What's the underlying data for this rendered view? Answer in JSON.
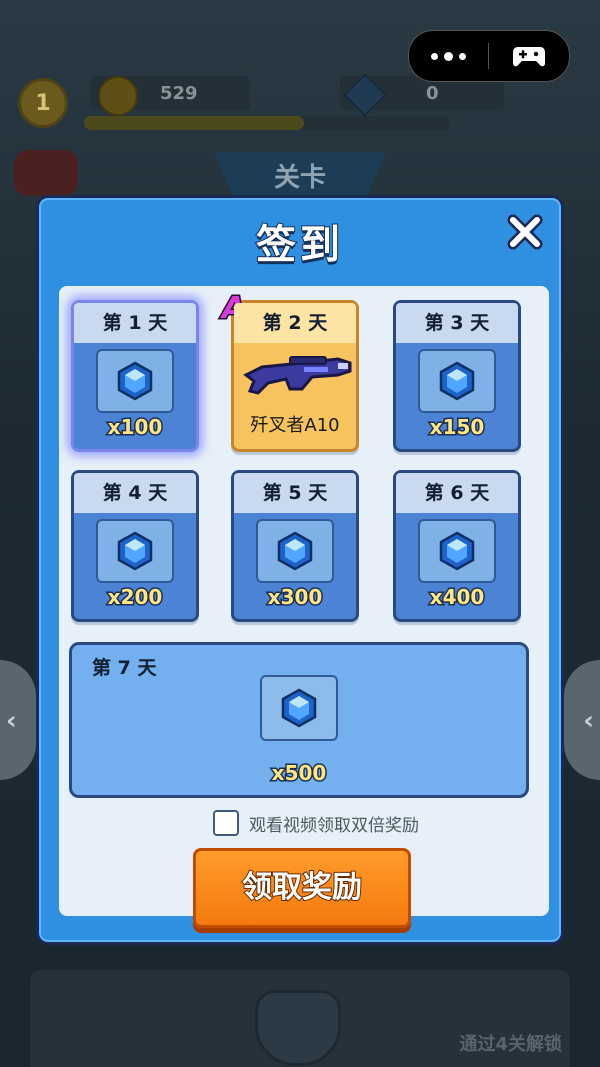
{
  "background": {
    "level": "1",
    "coins": "529",
    "gems": "0",
    "stage_label": "关卡",
    "unlock_text": "通过4关解锁"
  },
  "signin": {
    "title": "签到",
    "days": [
      {
        "label": "第 1 天",
        "reward_icon": "gem-icon",
        "amount": "x100",
        "state": "today"
      },
      {
        "label": "第 2 天",
        "reward_icon": "rifle-icon",
        "item_name": "歼叉者A10",
        "rank": "A",
        "state": "special"
      },
      {
        "label": "第 3 天",
        "reward_icon": "gem-icon",
        "amount": "x150"
      },
      {
        "label": "第 4 天",
        "reward_icon": "gem-icon",
        "amount": "x200"
      },
      {
        "label": "第 5 天",
        "reward_icon": "gem-icon",
        "amount": "x300"
      },
      {
        "label": "第 6 天",
        "reward_icon": "gem-icon",
        "amount": "x400"
      },
      {
        "label": "第 7 天",
        "reward_icon": "gem-icon",
        "amount": "x500"
      }
    ],
    "double_reward_label": "观看视频领取双倍奖励",
    "claim_button": "领取奖励"
  },
  "colors": {
    "panel_blue": "#2f8fe0",
    "card_blue": "#4d83d4",
    "claim_orange": "#f57a0e",
    "amount_yellow": "#ffe680",
    "rank_purple": "#d93bd8"
  }
}
